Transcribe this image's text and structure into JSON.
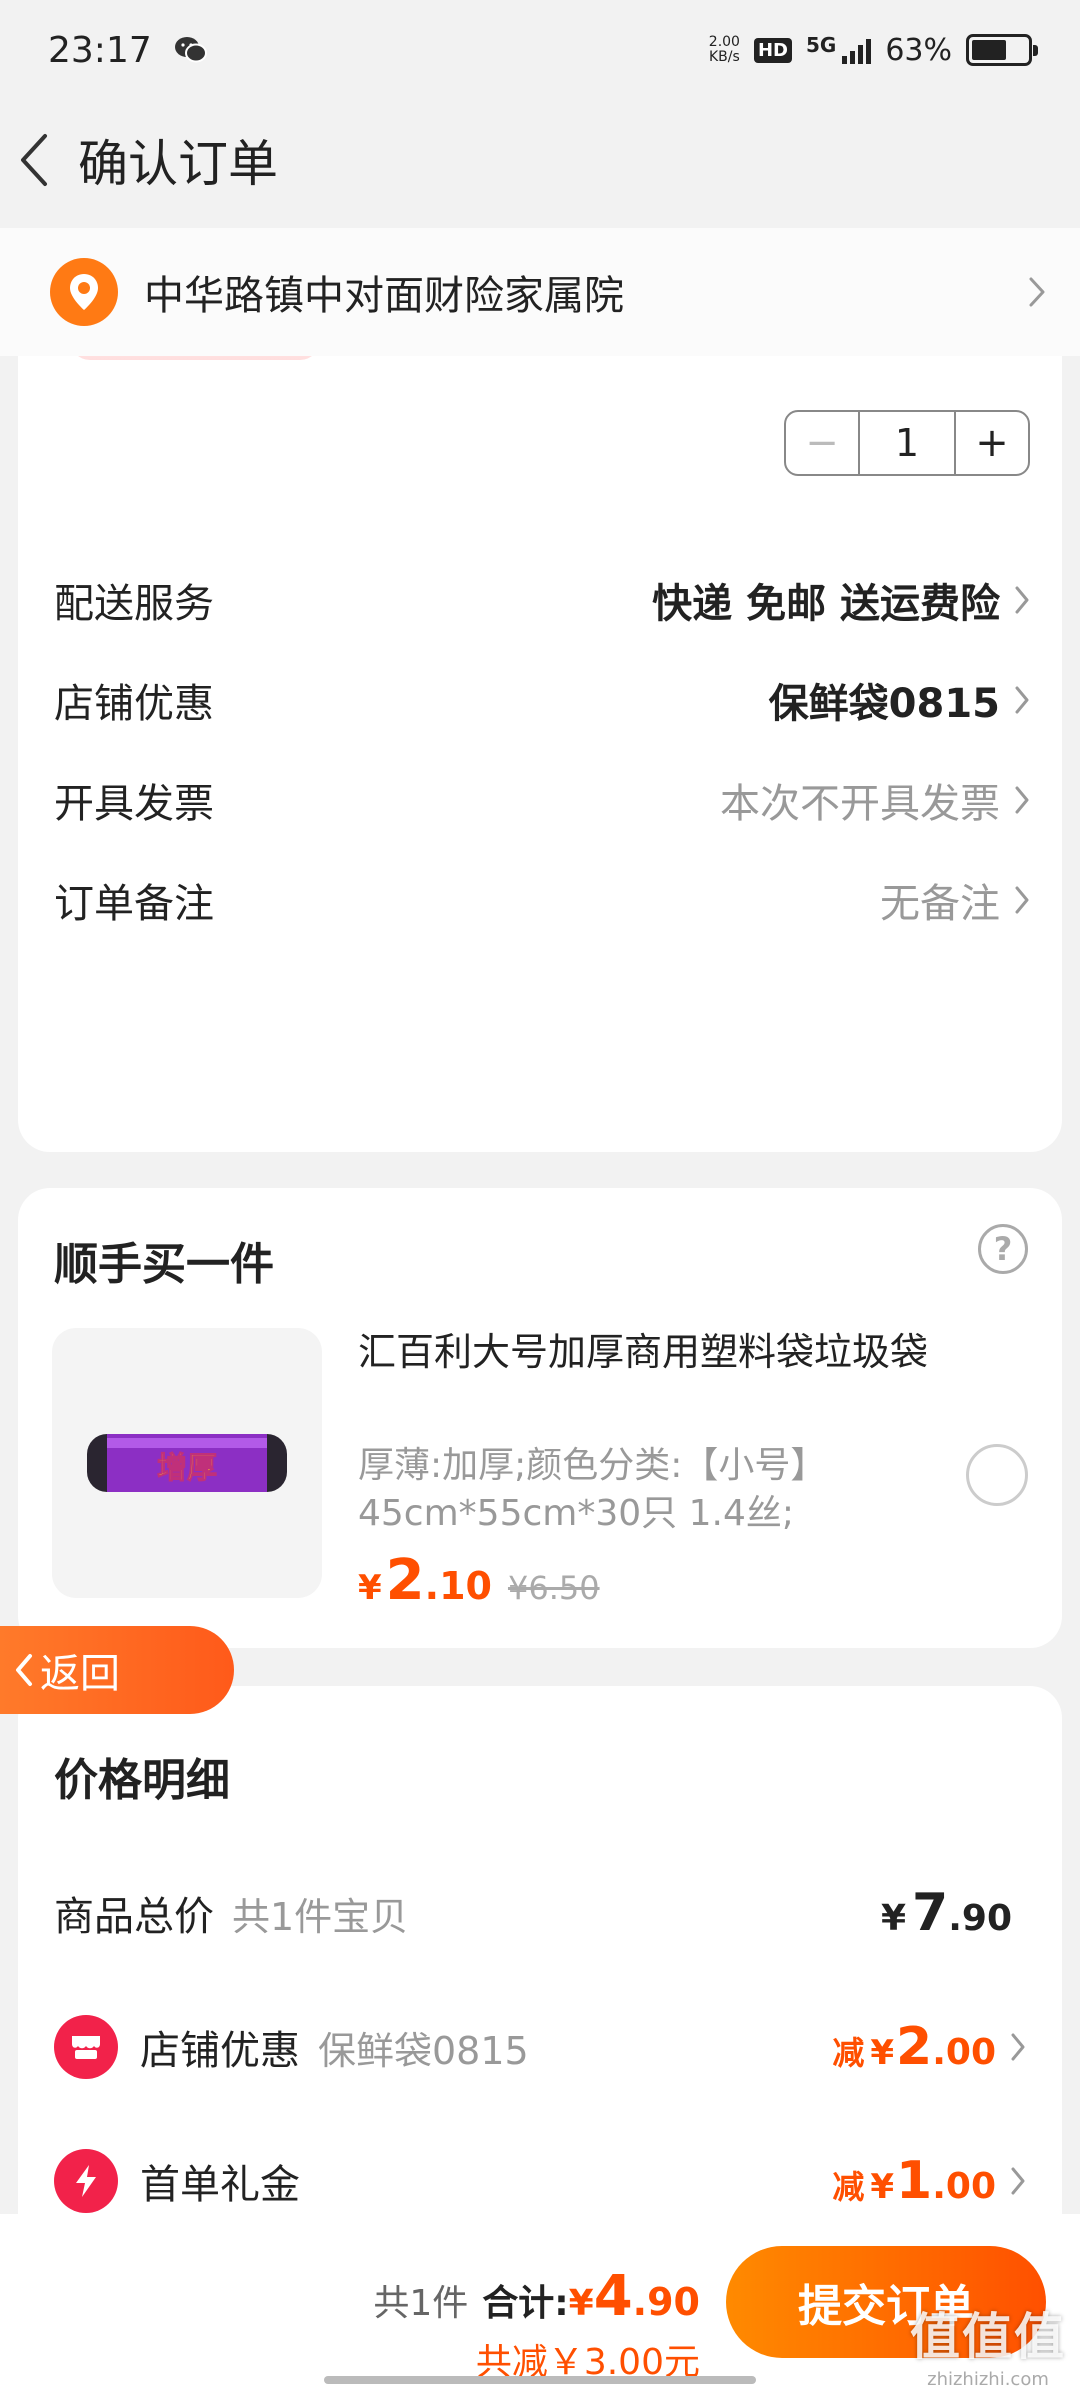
{
  "status_bar": {
    "time": "23:17",
    "net_speed_value": "2.00",
    "net_speed_unit": "KB/s",
    "hd": "HD",
    "network": "5G",
    "battery": "63%",
    "battery_level": 0.63
  },
  "nav": {
    "title": "确认订单"
  },
  "address": {
    "text": "中华路镇中对面财险家属院"
  },
  "quantity": {
    "value": "1",
    "minus": "−",
    "plus": "+"
  },
  "order_rows": [
    {
      "label": "配送服务",
      "value": "快递 免邮 送运费险"
    },
    {
      "label": "店铺优惠",
      "value": "保鲜袋0815"
    },
    {
      "label": "开具发票",
      "value": "本次不开具发票"
    },
    {
      "label": "订单备注",
      "value": "无备注"
    }
  ],
  "addon": {
    "title": "顺手买一件",
    "help": "?",
    "product_name": "汇百利大号加厚商用塑料袋垃圾袋",
    "product_image_text": "增厚",
    "spec": "厚薄:加厚;颜色分类:【小号】45cm*55cm*30只 1.4丝;",
    "price_currency": "¥",
    "price_int": "2",
    "price_dec": ".10",
    "original_price": "¥6.50"
  },
  "float_back": {
    "label": "返回"
  },
  "price_detail": {
    "title": "价格明细",
    "rows": [
      {
        "label": "商品总价",
        "sub": "共1件宝贝",
        "prefix": "",
        "currency": "¥",
        "int": "7",
        "dec": ".90"
      },
      {
        "label": "店铺优惠",
        "sub": "保鲜袋0815",
        "prefix": "减",
        "currency": "¥",
        "int": "2",
        "dec": ".00"
      },
      {
        "label": "首单礼金",
        "sub": "",
        "prefix": "减",
        "currency": "¥",
        "int": "1",
        "dec": ".00"
      }
    ]
  },
  "bottom": {
    "count": "共1件",
    "sum_label": "合计:",
    "currency": "¥",
    "int": "4",
    "dec": ".90",
    "saved": "共减￥3.00元",
    "submit": "提交订单"
  },
  "watermark": {
    "big": "值值值",
    "small": "zhizhizhi.com"
  },
  "colors": {
    "accent": "#ff4f00",
    "address_icon": "#ff7a14",
    "badge": "#f2224a"
  }
}
